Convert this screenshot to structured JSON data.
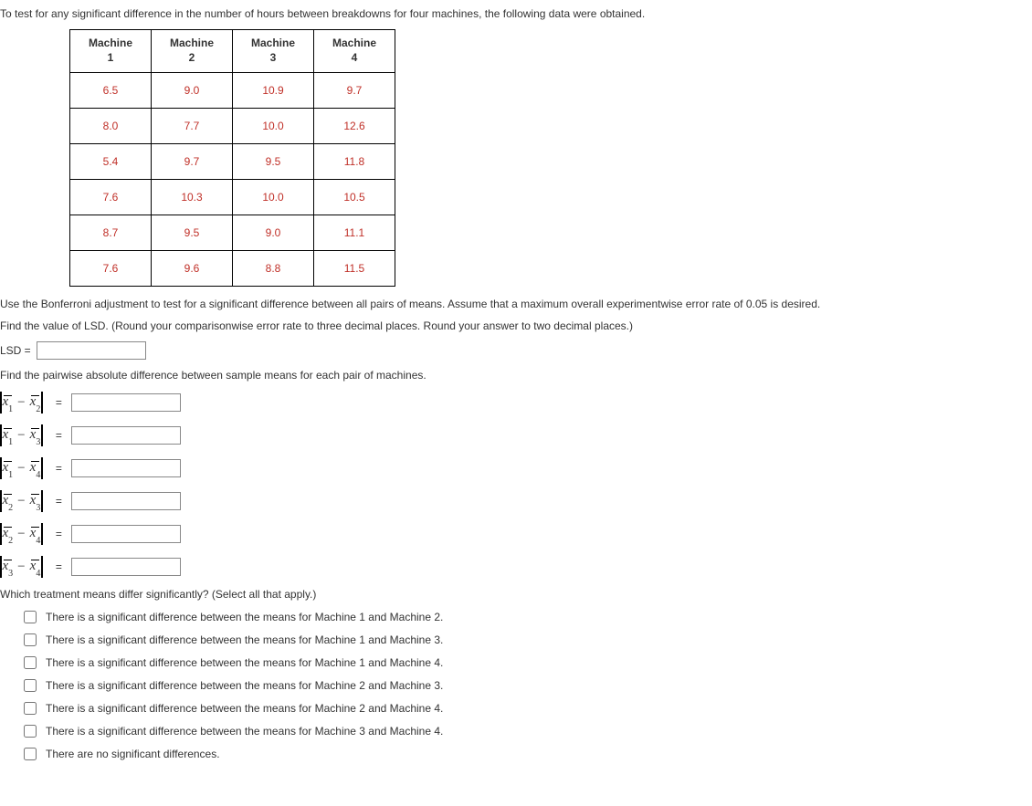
{
  "intro": "To test for any significant difference in the number of hours between breakdowns for four machines, the following data were obtained.",
  "table": {
    "headers": [
      "Machine 1",
      "Machine 2",
      "Machine 3",
      "Machine 4"
    ],
    "rows": [
      [
        "6.5",
        "9.0",
        "10.9",
        "9.7"
      ],
      [
        "8.0",
        "7.7",
        "10.0",
        "12.6"
      ],
      [
        "5.4",
        "9.7",
        "9.5",
        "11.8"
      ],
      [
        "7.6",
        "10.3",
        "10.0",
        "10.5"
      ],
      [
        "8.7",
        "9.5",
        "9.0",
        "11.1"
      ],
      [
        "7.6",
        "9.6",
        "8.8",
        "11.5"
      ]
    ]
  },
  "p1": "Use the Bonferroni adjustment to test for a significant difference between all pairs of means. Assume that a maximum overall experimentwise error rate of 0.05 is desired.",
  "p2": "Find the value of LSD. (Round your comparisonwise error rate to three decimal places. Round your answer to two decimal places.)",
  "lsd_label": "LSD =",
  "p3": "Find the pairwise absolute difference between sample means for each pair of machines.",
  "pairs": [
    {
      "a": "1",
      "b": "2"
    },
    {
      "a": "1",
      "b": "3"
    },
    {
      "a": "1",
      "b": "4"
    },
    {
      "a": "2",
      "b": "3"
    },
    {
      "a": "2",
      "b": "4"
    },
    {
      "a": "3",
      "b": "4"
    }
  ],
  "q": "Which treatment means differ significantly? (Select all that apply.)",
  "options": [
    "There is a significant difference between the means for Machine 1 and Machine 2.",
    "There is a significant difference between the means for Machine 1 and Machine 3.",
    "There is a significant difference between the means for Machine 1 and Machine 4.",
    "There is a significant difference between the means for Machine 2 and Machine 3.",
    "There is a significant difference between the means for Machine 2 and Machine 4.",
    "There is a significant difference between the means for Machine 3 and Machine 4.",
    "There are no significant differences."
  ]
}
